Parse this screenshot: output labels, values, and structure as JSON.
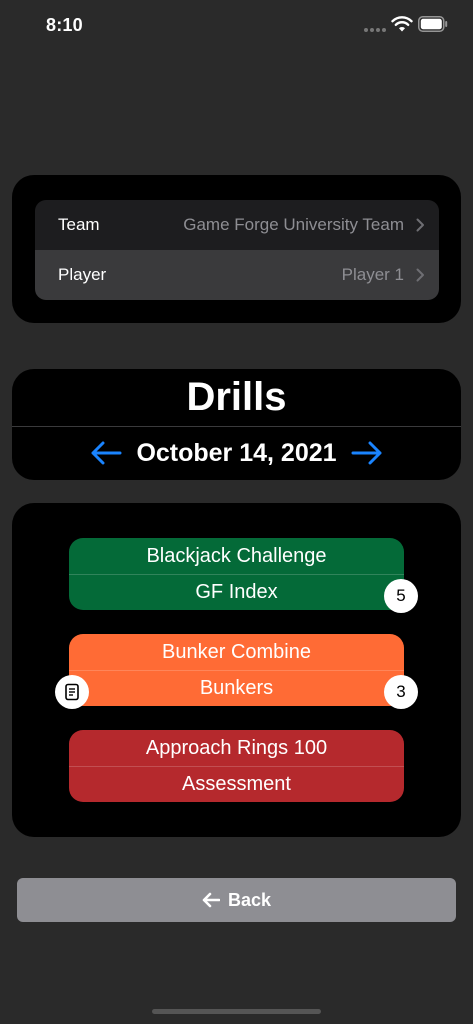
{
  "status_bar": {
    "time": "8:10"
  },
  "selection": {
    "team_label": "Team",
    "team_value": "Game Forge University Team",
    "player_label": "Player",
    "player_value": "Player 1"
  },
  "header": {
    "title": "Drills",
    "date": "October 14, 2021"
  },
  "drills": [
    {
      "name": "Blackjack Challenge",
      "category": "GF Index",
      "count": "5",
      "color": "#046a38"
    },
    {
      "name": "Bunker Combine",
      "category": "Bunkers",
      "count": "3",
      "color": "#ff6b35",
      "has_notes": true
    },
    {
      "name": "Approach Rings 100",
      "category": "Assessment",
      "color": "#b5292d"
    }
  ],
  "footer": {
    "back_label": "Back"
  },
  "colors": {
    "accent": "#1a84ff",
    "background": "#2a2a2a"
  }
}
